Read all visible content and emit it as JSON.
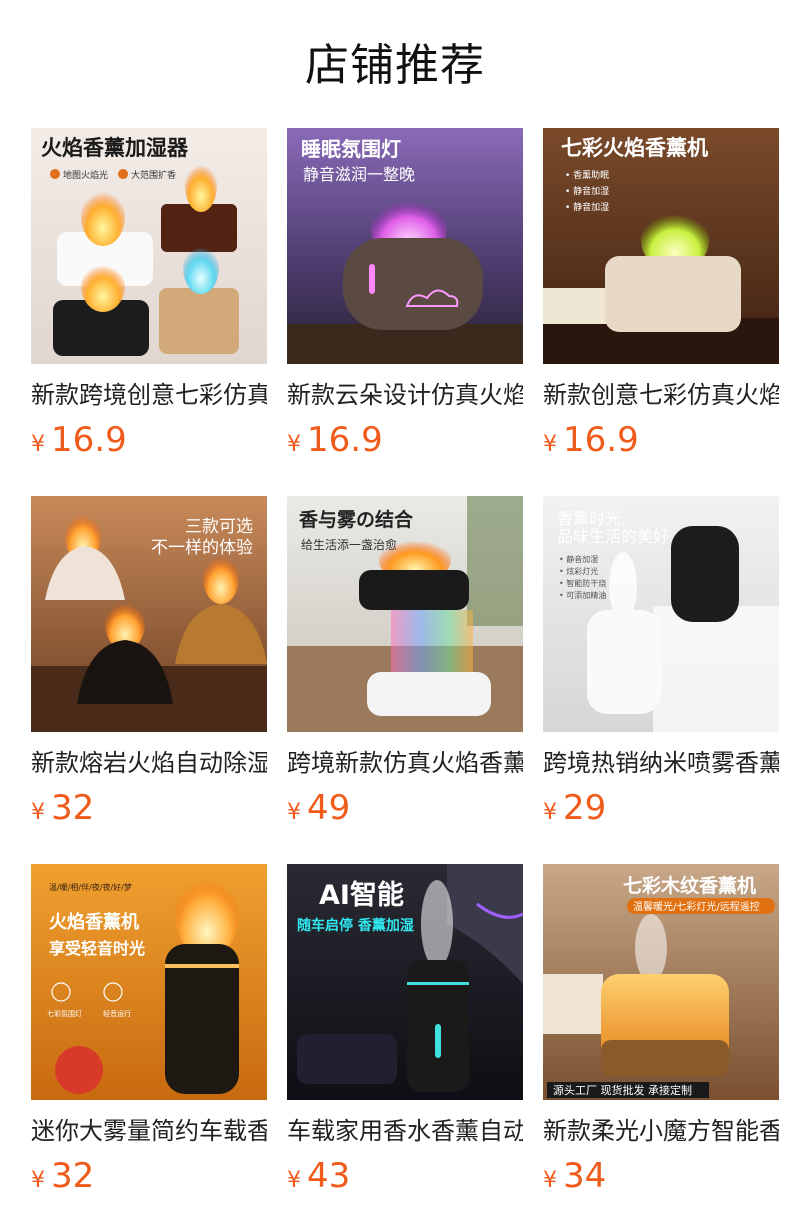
{
  "page_title": "店铺推荐",
  "currency": "¥",
  "colors": {
    "price": "#f05a1a",
    "title": "#111111",
    "text": "#222222"
  },
  "products": [
    {
      "name": "新款跨境创意七彩仿真火焰香薰加湿器",
      "price": "16.9",
      "overlay": {
        "headline": "火焰香薰加湿器",
        "sub": "",
        "tags": [
          "地图火焰光",
          "大范围扩香"
        ],
        "banner": ""
      }
    },
    {
      "name": "新款云朵设计仿真火焰香薰机",
      "price": "16.9",
      "overlay": {
        "headline": "睡眠氛围灯",
        "sub": "静音滋润一整晚",
        "tags": [],
        "banner": ""
      }
    },
    {
      "name": "新款创意七彩仿真火焰香薰机",
      "price": "16.9",
      "overlay": {
        "headline": "七彩火焰香薰机",
        "sub": "",
        "tags": [
          "• 香薰助眠",
          "• 静音加湿",
          "• 静音加湿"
        ],
        "banner": ""
      }
    },
    {
      "name": "新款熔岩火焰自动除湿香薰机",
      "price": "32",
      "overlay": {
        "headline": "三款可选",
        "sub": "不一样的体验",
        "tags": [],
        "banner": ""
      }
    },
    {
      "name": "跨境新款仿真火焰香薰加湿器",
      "price": "49",
      "overlay": {
        "headline": "香与雾の结合",
        "sub": "给生活添一盏治愈",
        "tags": [],
        "banner": ""
      }
    },
    {
      "name": "跨境热销纳米喷雾香薰机",
      "price": "29",
      "overlay": {
        "headline": "香薰时光,",
        "sub": "品味生活的美好",
        "tags": [
          "• 静音加湿",
          "• 炫彩灯光",
          "• 智能防干烧",
          "• 可添加精油"
        ],
        "banner": ""
      }
    },
    {
      "name": "迷你大雾量简约车载香薰机",
      "price": "32",
      "overlay": {
        "headline": "火焰香薰机",
        "sub": "享受轻音时光",
        "tags": [
          "温/暖/相/伴/夜/夜/好/梦",
          "七彩氛围灯",
          "轻音运行"
        ],
        "banner": ""
      }
    },
    {
      "name": "车载家用香水香薰自动喷雾器",
      "price": "43",
      "overlay": {
        "headline": "AI智能",
        "sub": "随车启停 香薰加湿",
        "tags": [],
        "banner": ""
      }
    },
    {
      "name": "新款柔光小魔方智能香薰机",
      "price": "34",
      "overlay": {
        "headline": "七彩木纹香薰机",
        "sub": "温馨暖光/七彩灯光/远程遥控",
        "tags": [],
        "banner": "源头工厂  现货批发  承接定制"
      }
    }
  ]
}
